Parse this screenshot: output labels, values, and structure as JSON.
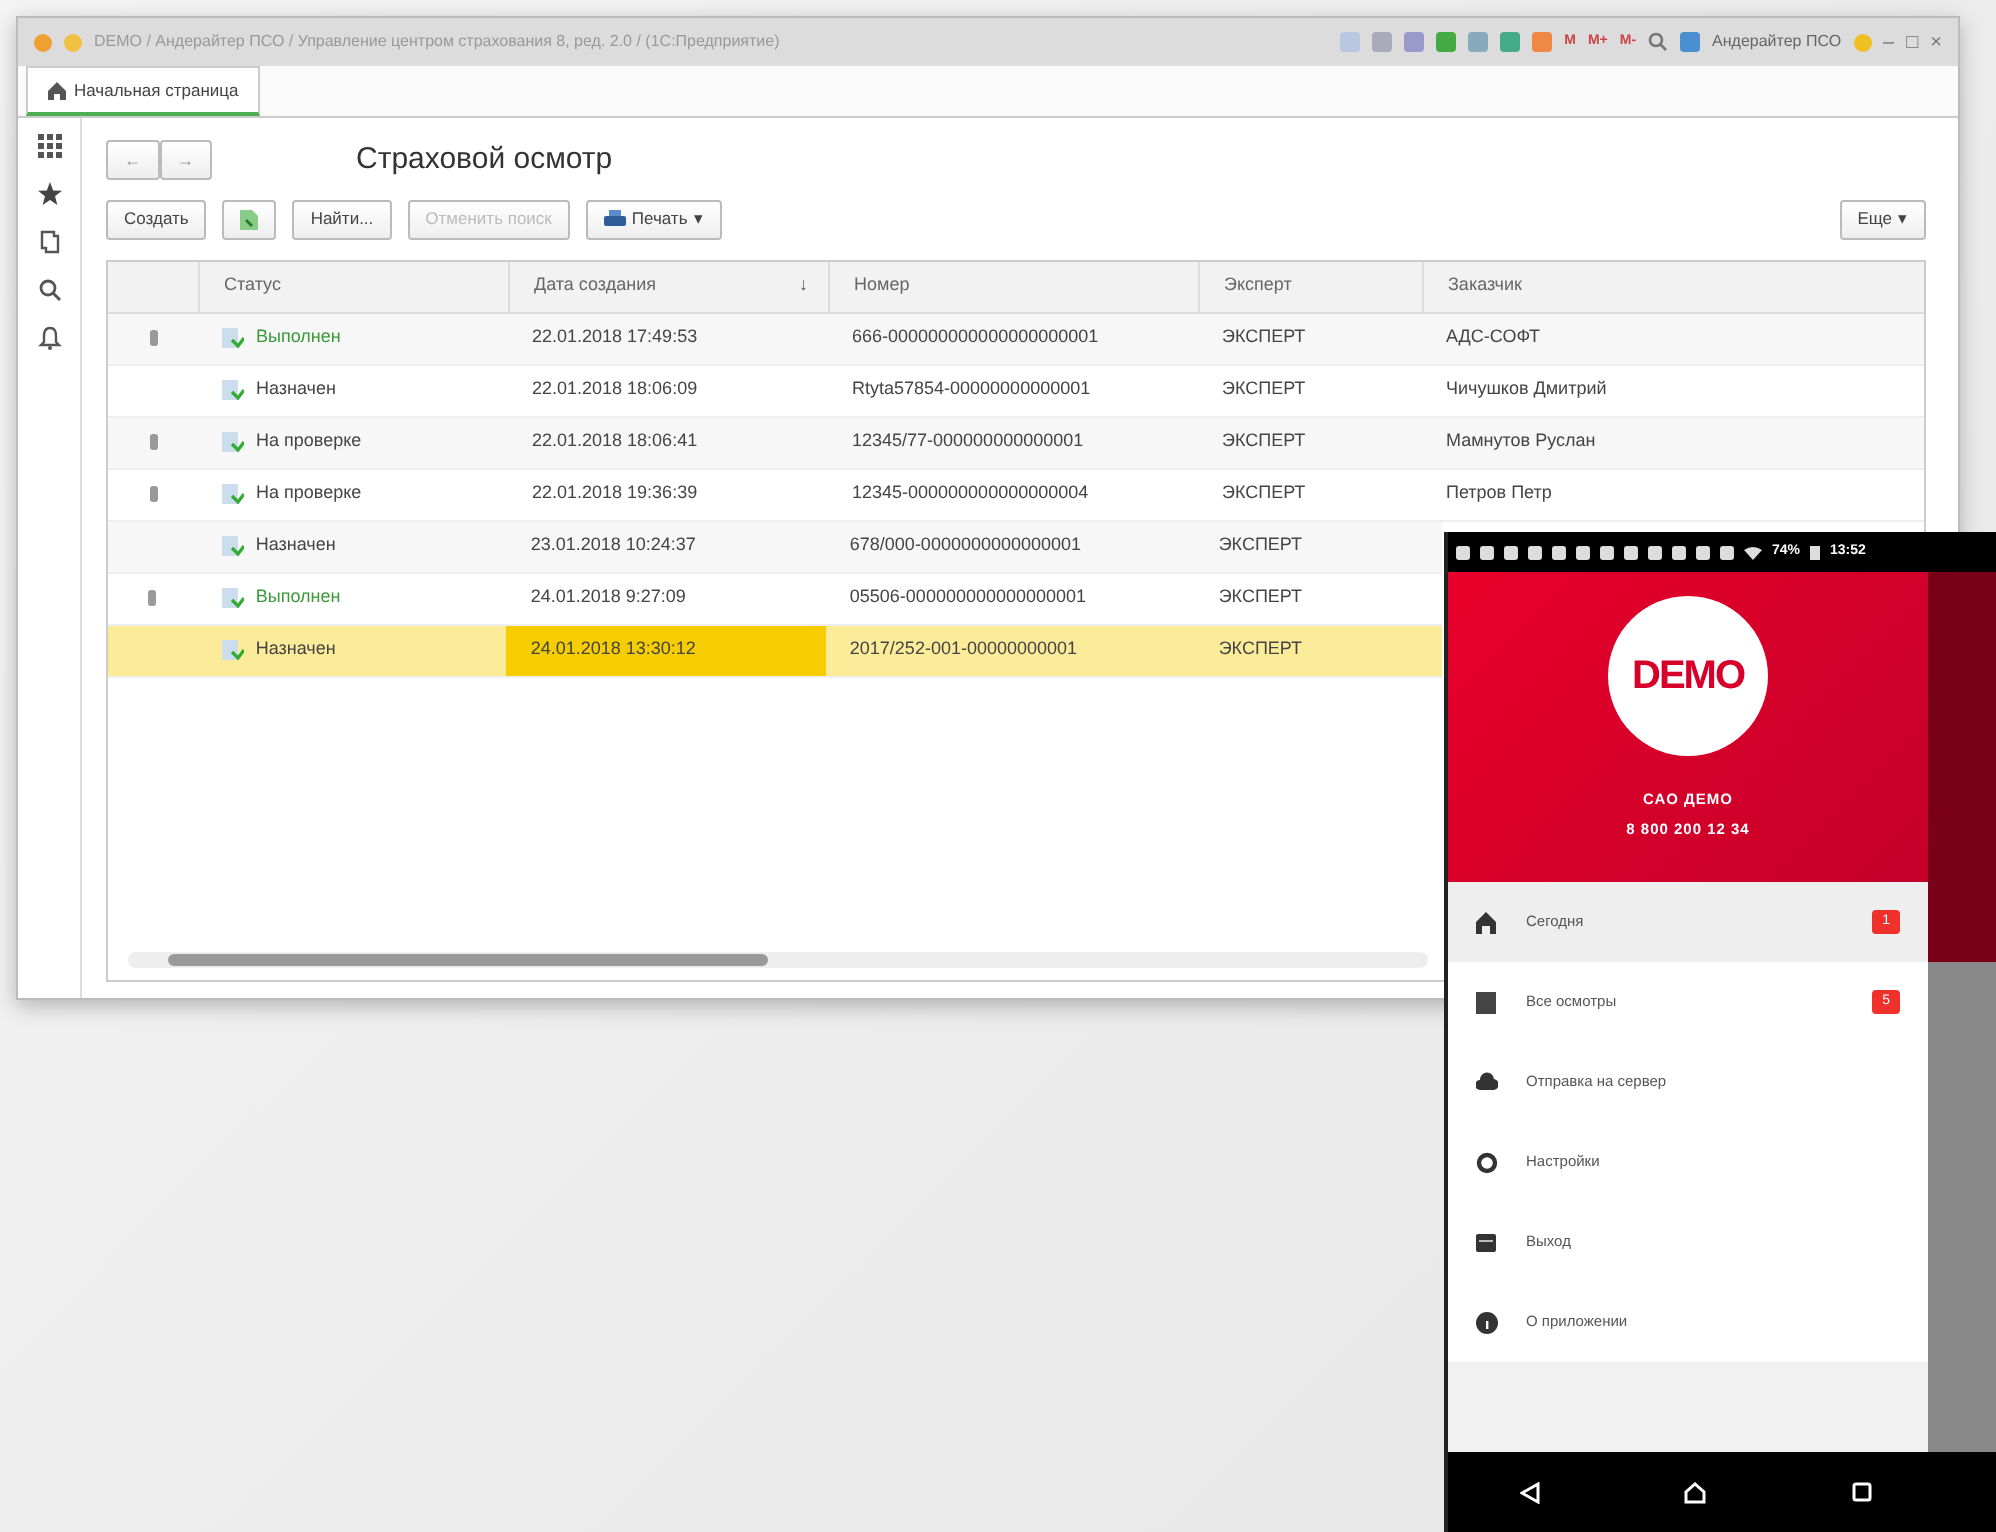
{
  "window": {
    "title": "DEMO / Андерайтер ПСО / Управление центром страхования 8, ред. 2.0 / (1С:Предприятие)",
    "memory_buttons": [
      "M",
      "M+",
      "M-"
    ],
    "user": "Андерайтер ПСО",
    "controls": [
      "–",
      "□",
      "×"
    ]
  },
  "tabs": [
    {
      "label": "Начальная страница",
      "selected": true
    }
  ],
  "form": {
    "title": "Страховой осмотр",
    "nav": [
      "←",
      "→"
    ],
    "toolbar": [
      {
        "kind": "text",
        "label": "Создать",
        "disabled": false
      },
      {
        "kind": "icon",
        "disabled": false
      },
      {
        "kind": "text",
        "label": "Найти...",
        "disabled": false
      },
      {
        "kind": "text",
        "label": "Отменить поиск",
        "disabled": true
      },
      {
        "kind": "menu",
        "label": "Печать",
        "caret": "▾",
        "disabled": false
      }
    ],
    "more_button": {
      "label": "Еще",
      "caret": "▾"
    },
    "table": {
      "columns": [
        "Статус",
        "Дата создания",
        "Номер",
        "Эксперт",
        "Заказчик"
      ],
      "sort_mark": "↓",
      "rows": [
        {
          "marked": true,
          "status": "Выполнен",
          "color": "#3a9a3a",
          "date": "22.01.2018 17:49:53",
          "number": "666-000000000000000000001",
          "expert": "ЭКСПЕРТ",
          "customer": "АДС-СОФТ",
          "selected": false
        },
        {
          "marked": false,
          "status": "Назначен",
          "color": "#444444",
          "date": "22.01.2018 18:06:09",
          "number": "Rtyta57854-00000000000001",
          "expert": "ЭКСПЕРТ",
          "customer": "Чичушков Дмитрий",
          "selected": false
        },
        {
          "marked": true,
          "status": "На проверке",
          "color": "#444444",
          "date": "22.01.2018 18:06:41",
          "number": "12345/77-000000000000001",
          "expert": "ЭКСПЕРТ",
          "customer": "Мамнутов Руслан",
          "selected": false
        },
        {
          "marked": true,
          "status": "На проверке",
          "color": "#444444",
          "date": "22.01.2018 19:36:39",
          "number": "12345-000000000000000004",
          "expert": "ЭКСПЕРТ",
          "customer": "Петров Петр",
          "selected": false
        },
        {
          "marked": false,
          "status": "Назначен",
          "color": "#444444",
          "date": "23.01.2018 10:24:37",
          "number": "678/000-0000000000000001",
          "expert": "ЭКСПЕРТ",
          "selected": false
        },
        {
          "marked": true,
          "status": "Выполнен",
          "color": "#3a9a3a",
          "date": "24.01.2018 9:27:09",
          "number": "05506-000000000000000001",
          "expert": "ЭКСПЕРТ",
          "selected": false
        },
        {
          "marked": false,
          "status": "Назначен",
          "color": "#444444",
          "date": "24.01.2018 13:30:12",
          "number": "2017/252-001-00000000001",
          "expert": "ЭКСПЕРТ",
          "selected": true
        }
      ]
    }
  },
  "phone": {
    "status_bar": {
      "battery": "74%",
      "time": "13:52"
    },
    "logo": "DEMO",
    "company": "САО ДЕМО",
    "phone_number": "8 800 200 12 34",
    "menu": [
      {
        "kind": "home",
        "label": "Сегодня",
        "badge": "1",
        "selected": true
      },
      {
        "kind": "list",
        "label": "Все осмотры",
        "badge": "5",
        "selected": false
      },
      {
        "kind": "cloud",
        "label": "Отправка на сервер",
        "selected": false
      },
      {
        "kind": "settings",
        "label": "Настройки",
        "selected": false
      },
      {
        "kind": "exit",
        "label": "Выход",
        "selected": false
      },
      {
        "kind": "info",
        "label": "О приложении",
        "selected": false
      }
    ]
  }
}
